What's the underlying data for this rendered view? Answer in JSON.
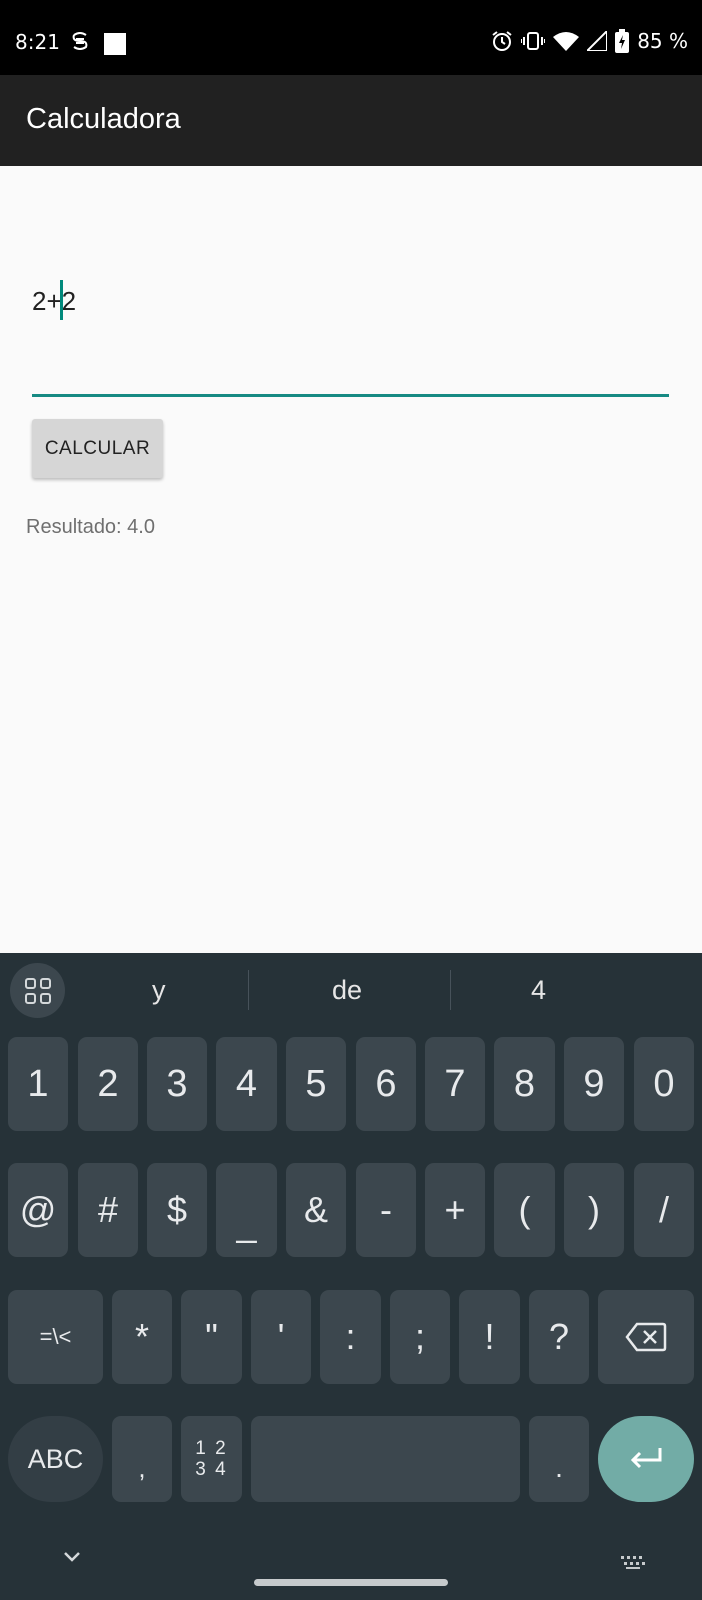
{
  "status_bar": {
    "time": "8:21",
    "battery": "85 %",
    "icons": [
      "settings-icon",
      "square-icon",
      "alarm-icon",
      "vibrate-icon",
      "wifi-icon",
      "signal-icon",
      "battery-icon"
    ]
  },
  "app_bar": {
    "title": "Calculadora"
  },
  "main": {
    "expression_value": "2+2",
    "calculate_label": "CALCULAR",
    "result_text": "Resultado: 4.0",
    "accent_color": "#168a83"
  },
  "keyboard": {
    "suggestions": [
      "y",
      "de",
      "4"
    ],
    "row1": [
      "1",
      "2",
      "3",
      "4",
      "5",
      "6",
      "7",
      "8",
      "9",
      "0"
    ],
    "row2": [
      "@",
      "#",
      "$",
      "_",
      "&",
      "-",
      "+",
      "(",
      ")",
      "/"
    ],
    "row3": [
      "=\\<",
      "*",
      "\"",
      "'",
      ":",
      ";",
      "!",
      "?"
    ],
    "abc_label": "ABC",
    "comma_label": ",",
    "numpad_label_top": "1 2",
    "numpad_label_bottom": "3 4",
    "period_label": ".",
    "enter_color": "#72aca6"
  }
}
